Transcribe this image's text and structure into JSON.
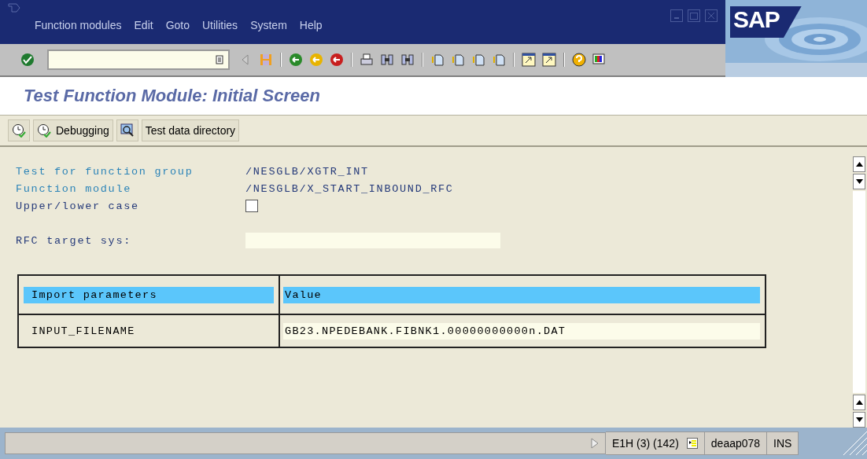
{
  "window": {
    "menu": [
      "Function modules",
      "Edit",
      "Goto",
      "Utilities",
      "System",
      "Help"
    ],
    "logo": "SAP"
  },
  "title": "Test Function Module: Initial Screen",
  "app_toolbar": [
    {
      "kind": "execute"
    },
    {
      "kind": "debug",
      "label": "Debugging"
    },
    {
      "kind": "inspect"
    },
    {
      "kind": "text",
      "label": "Test data directory"
    }
  ],
  "fields": [
    {
      "kind": "text",
      "label": "Test for function group",
      "value": "/NESGLB/XGTR_INT"
    },
    {
      "kind": "text",
      "label": "Function module",
      "value": "/NESGLB/X_START_INBOUND_RFC"
    },
    {
      "kind": "checkbox",
      "label": "Upper/lower case",
      "checked": false
    },
    {
      "kind": "input",
      "label": "RFC target sys:"
    }
  ],
  "table": {
    "columns": [
      "Import parameters",
      "Value"
    ],
    "rows": [
      [
        "INPUT_FILENAME",
        "GB23.NPEDEBANK.FIBNK1.00000000000n.DAT"
      ]
    ]
  },
  "status_bar": {
    "system": "E1H (3) (142)",
    "server": "deaap078",
    "mode": "INS"
  }
}
